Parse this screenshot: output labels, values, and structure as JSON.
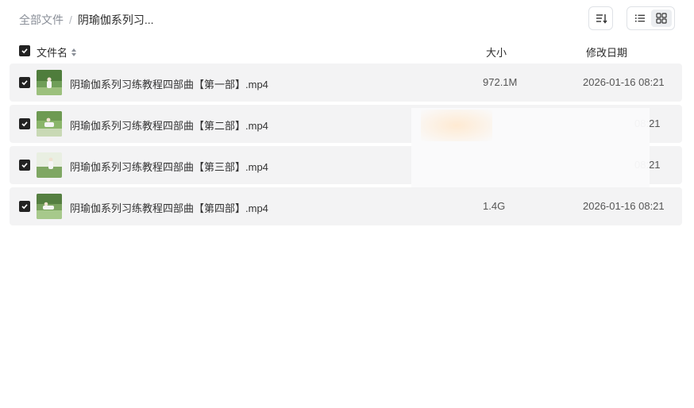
{
  "breadcrumb": {
    "root": "全部文件",
    "separator": "/",
    "current": "阴瑜伽系列习..."
  },
  "toolbar": {
    "sort_icon": "sort-icon",
    "list_view_icon": "list-view-icon",
    "grid_view_icon": "grid-view-icon"
  },
  "columns": {
    "name": "文件名",
    "size": "大小",
    "date": "修改日期"
  },
  "files": [
    {
      "name": "阴瑜伽系列习练教程四部曲【第一部】.mp4",
      "size": "972.1M",
      "date": "2026-01-16 08:21",
      "thumb_color": "#5f8a4a"
    },
    {
      "name": "阴瑜伽系列习练教程四部曲【第二部】.mp4",
      "size": "",
      "date": "08:21",
      "thumb_color": "#7aa15a"
    },
    {
      "name": "阴瑜伽系列习练教程四部曲【第三部】.mp4",
      "size": "",
      "date": "08:21",
      "thumb_color": "#a9c48d"
    },
    {
      "name": "阴瑜伽系列习练教程四部曲【第四部】.mp4",
      "size": "1.4G",
      "date": "2026-01-16 08:21",
      "thumb_color": "#6e9a54"
    }
  ]
}
